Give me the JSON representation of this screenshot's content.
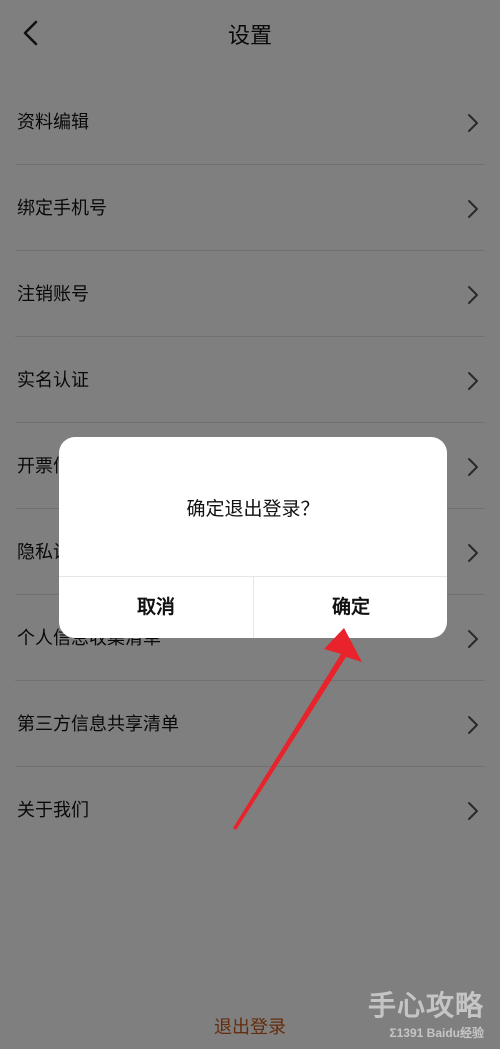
{
  "header": {
    "title": "设置",
    "back_icon": "chevron-left-icon"
  },
  "settings": {
    "items": [
      {
        "label": "资料编辑"
      },
      {
        "label": "绑定手机号"
      },
      {
        "label": "注销账号"
      },
      {
        "label": "实名认证"
      },
      {
        "label": "开票信息"
      },
      {
        "label": "隐私设置"
      },
      {
        "label": "个人信息收集清单"
      },
      {
        "label": "第三方信息共享清单"
      },
      {
        "label": "关于我们"
      }
    ],
    "logout_label": "退出登录"
  },
  "dialog": {
    "message": "确定退出登录？",
    "cancel_label": "取消",
    "confirm_label": "确定"
  },
  "annotation": {
    "arrow_color": "#e8232b",
    "points_to": "confirm-button"
  },
  "watermark": {
    "line1": "手心攻略",
    "line2": "Σ1391 Baidu经验"
  },
  "colors": {
    "logout": "#c85a1a",
    "overlay": "rgba(0,0,0,0.5)"
  }
}
